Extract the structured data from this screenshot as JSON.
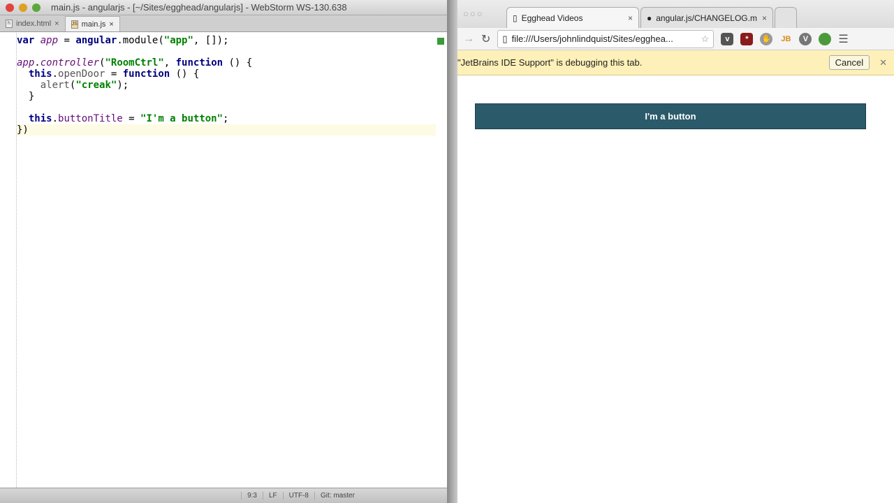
{
  "ide": {
    "title": "main.js - angularjs - [~/Sites/egghead/angularjs] - WebStorm WS-130.638",
    "tabs": [
      {
        "label": "index.html",
        "icon": "h"
      },
      {
        "label": "main.js",
        "icon": "JS"
      }
    ],
    "code": [
      [
        [
          "k",
          "var "
        ],
        [
          "v",
          "app"
        ],
        [
          "m",
          " = "
        ],
        [
          "k",
          "angular"
        ],
        [
          "m",
          ".module("
        ],
        [
          "s",
          "\"app\""
        ],
        [
          "m",
          ", []);"
        ]
      ],
      [],
      [
        [
          "v",
          "app"
        ],
        [
          "m",
          "."
        ],
        [
          "v",
          "controller"
        ],
        [
          "m",
          "("
        ],
        [
          "s",
          "\"RoomCtrl\""
        ],
        [
          "m",
          ", "
        ],
        [
          "k",
          "function"
        ],
        [
          "m",
          " () {"
        ]
      ],
      [
        [
          "m",
          "  "
        ],
        [
          "k",
          "this"
        ],
        [
          "m",
          "."
        ],
        [
          "g",
          "openDoor"
        ],
        [
          "m",
          " = "
        ],
        [
          "k",
          "function"
        ],
        [
          "m",
          " () {"
        ]
      ],
      [
        [
          "m",
          "    "
        ],
        [
          "g",
          "alert"
        ],
        [
          "m",
          "("
        ],
        [
          "s",
          "\"creak\""
        ],
        [
          "m",
          ");"
        ]
      ],
      [
        [
          "m",
          "  }"
        ]
      ],
      [],
      [
        [
          "m",
          "  "
        ],
        [
          "k",
          "this"
        ],
        [
          "m",
          "."
        ],
        [
          "p",
          "buttonTitle"
        ],
        [
          "m",
          " = "
        ],
        [
          "s",
          "\"I'm a button\""
        ],
        [
          "m",
          ";"
        ]
      ],
      [
        [
          "m",
          "})"
        ]
      ]
    ],
    "status": {
      "position": "9:3",
      "line_ending": "LF",
      "encoding": "UTF-8",
      "vcs": "Git: master"
    }
  },
  "browser": {
    "tabs": [
      {
        "label": "Egghead Videos"
      },
      {
        "label": "angular.js/CHANGELOG.m"
      }
    ],
    "url": "file:///Users/johnlindquist/Sites/egghea...",
    "infobar": {
      "message": "\"JetBrains IDE Support\" is debugging this tab.",
      "cancel": "Cancel"
    },
    "page_button": "I'm a button"
  }
}
